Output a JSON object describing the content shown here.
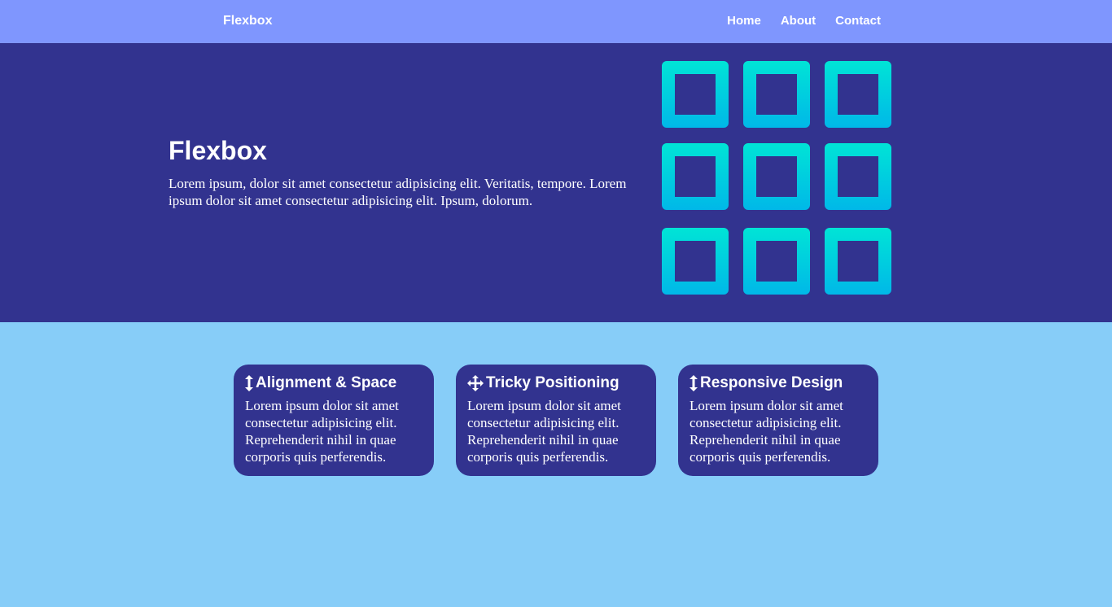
{
  "navbar": {
    "brand": "Flexbox",
    "links": [
      "Home",
      "About",
      "Contact"
    ],
    "background": "#7f96fe"
  },
  "hero": {
    "title": "Flexbox",
    "text": "Lorem ipsum, dolor sit amet consectetur adipisicing elit. Veritatis, tempore. Lorem ipsum dolor sit amet consectetur adipisicing elit. Ipsum, dolorum.",
    "background": "#32338f",
    "graphic": {
      "icon": "grid-3x3-icon",
      "gradient": [
        "#00e4d6",
        "#00b8e8"
      ]
    }
  },
  "features": {
    "cards": [
      {
        "icon": "arrows-vertical-icon",
        "title": "Alignment & Space",
        "text": "Lorem ipsum dolor sit amet consectetur adipisicing elit. Reprehenderit nihil in quae corporis quis perferendis."
      },
      {
        "icon": "arrows-move-icon",
        "title": "Tricky Positioning",
        "text": "Lorem ipsum dolor sit amet consectetur adipisicing elit. Reprehenderit nihil in quae corporis quis perferendis."
      },
      {
        "icon": "arrows-vertical-icon",
        "title": "Responsive Design",
        "text": "Lorem ipsum dolor sit amet consectetur adipisicing elit. Reprehenderit nihil in quae corporis quis perferendis."
      }
    ],
    "card_background": "#32338f",
    "section_background": "#87cdf8"
  }
}
